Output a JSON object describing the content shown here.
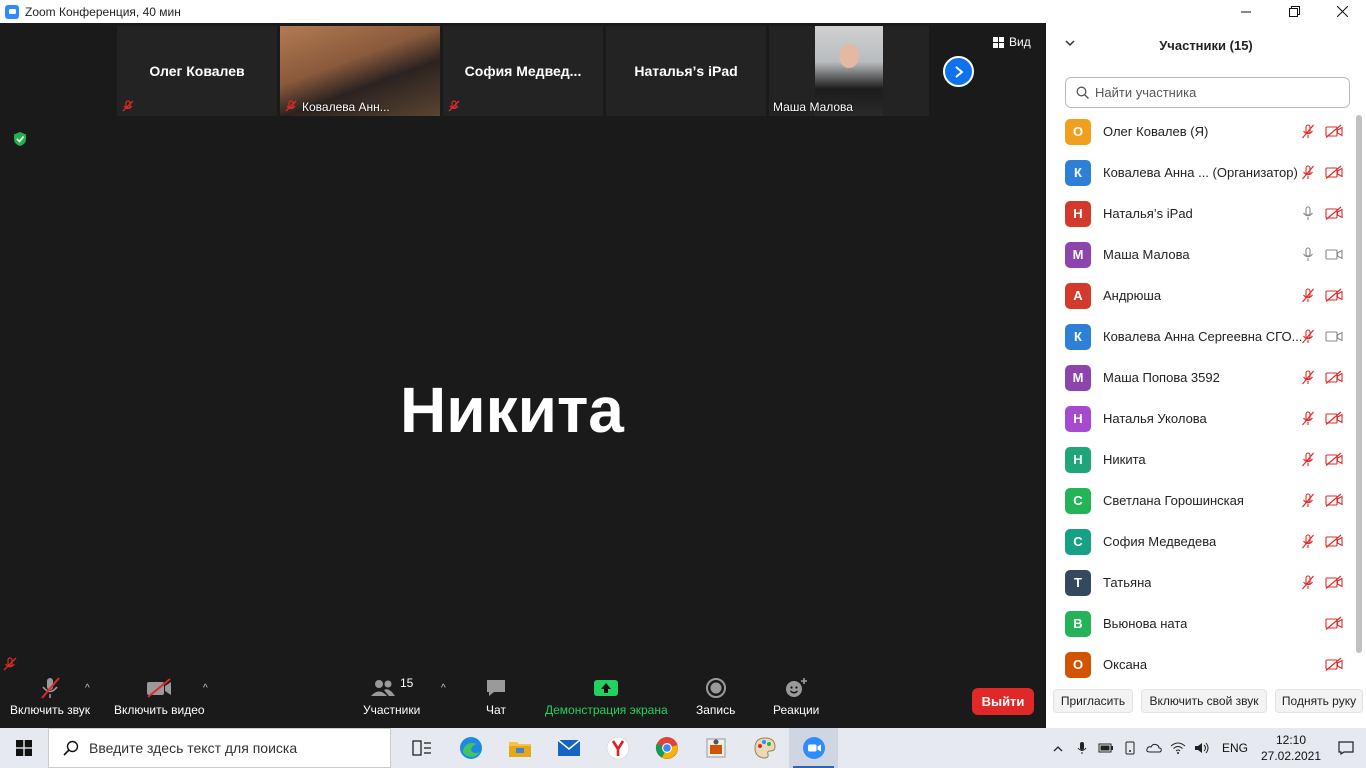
{
  "window": {
    "title": "Zoom Конференция, 40 мин",
    "controls": [
      "minimize",
      "maximize",
      "close"
    ]
  },
  "strip": {
    "tiles": [
      {
        "name": "Олег Ковалев",
        "type": "name",
        "muted": true
      },
      {
        "name": "Ковалева Анн...",
        "type": "video",
        "muted": true
      },
      {
        "name": "София  Медвед...",
        "type": "name",
        "muted": true
      },
      {
        "name": "Наталья’s iPad",
        "type": "name",
        "muted": false
      },
      {
        "name": "Маша Малова",
        "type": "video",
        "muted": false
      }
    ],
    "view_label": "Вид"
  },
  "main": {
    "speaker": "Никита"
  },
  "toolbar": {
    "unmute": "Включить звук",
    "video": "Включить видео",
    "participants": "Участники",
    "participants_count": "15",
    "chat": "Чат",
    "share": "Демонстрация экрана",
    "record": "Запись",
    "reactions": "Реакции",
    "leave": "Выйти"
  },
  "panel": {
    "title": "Участники (15)",
    "search_placeholder": "Найти участника",
    "participants": [
      {
        "initial": "О",
        "name": "Олег Ковалев (Я)",
        "color": "#f0a01e",
        "mic": "muted",
        "cam": "off"
      },
      {
        "initial": "К",
        "name": "Ковалева Анна ... (Организатор)",
        "color": "#2e7fd6",
        "mic": "muted",
        "cam": "off"
      },
      {
        "initial": "Н",
        "name": "Наталья’s iPad",
        "color": "#d23a2b",
        "mic": "on",
        "cam": "off"
      },
      {
        "initial": "М",
        "name": "Маша Малова",
        "color": "#8e44ad",
        "mic": "on",
        "cam": "on"
      },
      {
        "initial": "А",
        "name": "Андрюша",
        "color": "#d23a2b",
        "mic": "muted",
        "cam": "off"
      },
      {
        "initial": "К",
        "name": "Ковалева Анна Сергеевна СГО...",
        "color": "#2e7fd6",
        "mic": "muted",
        "cam": "on"
      },
      {
        "initial": "М",
        "name": "Маша Попова 3592",
        "color": "#8e44ad",
        "mic": "muted",
        "cam": "off"
      },
      {
        "initial": "Н",
        "name": "Наталья Уколова",
        "color": "#a64ad0",
        "mic": "muted",
        "cam": "off"
      },
      {
        "initial": "Н",
        "name": "Никита",
        "color": "#1fa57a",
        "mic": "muted",
        "cam": "off"
      },
      {
        "initial": "С",
        "name": "Светлана Горошинская",
        "color": "#25b35a",
        "mic": "muted",
        "cam": "off"
      },
      {
        "initial": "С",
        "name": "София Медведева",
        "color": "#16a085",
        "mic": "muted",
        "cam": "off"
      },
      {
        "initial": "Т",
        "name": "Татьяна",
        "color": "#34495e",
        "mic": "muted",
        "cam": "off"
      },
      {
        "initial": "В",
        "name": "Вьюнова ната",
        "color": "#25b35a",
        "mic": "none",
        "cam": "off"
      },
      {
        "initial": "О",
        "name": "Оксана",
        "color": "#d35400",
        "mic": "none",
        "cam": "off"
      }
    ],
    "footer": {
      "invite": "Пригласить",
      "unmute_me": "Включить свой звук",
      "raise_hand": "Поднять руку"
    }
  },
  "taskbar": {
    "search_placeholder": "Введите здесь текст для поиска",
    "lang": "ENG",
    "time": "12:10",
    "date": "27.02.2021"
  }
}
